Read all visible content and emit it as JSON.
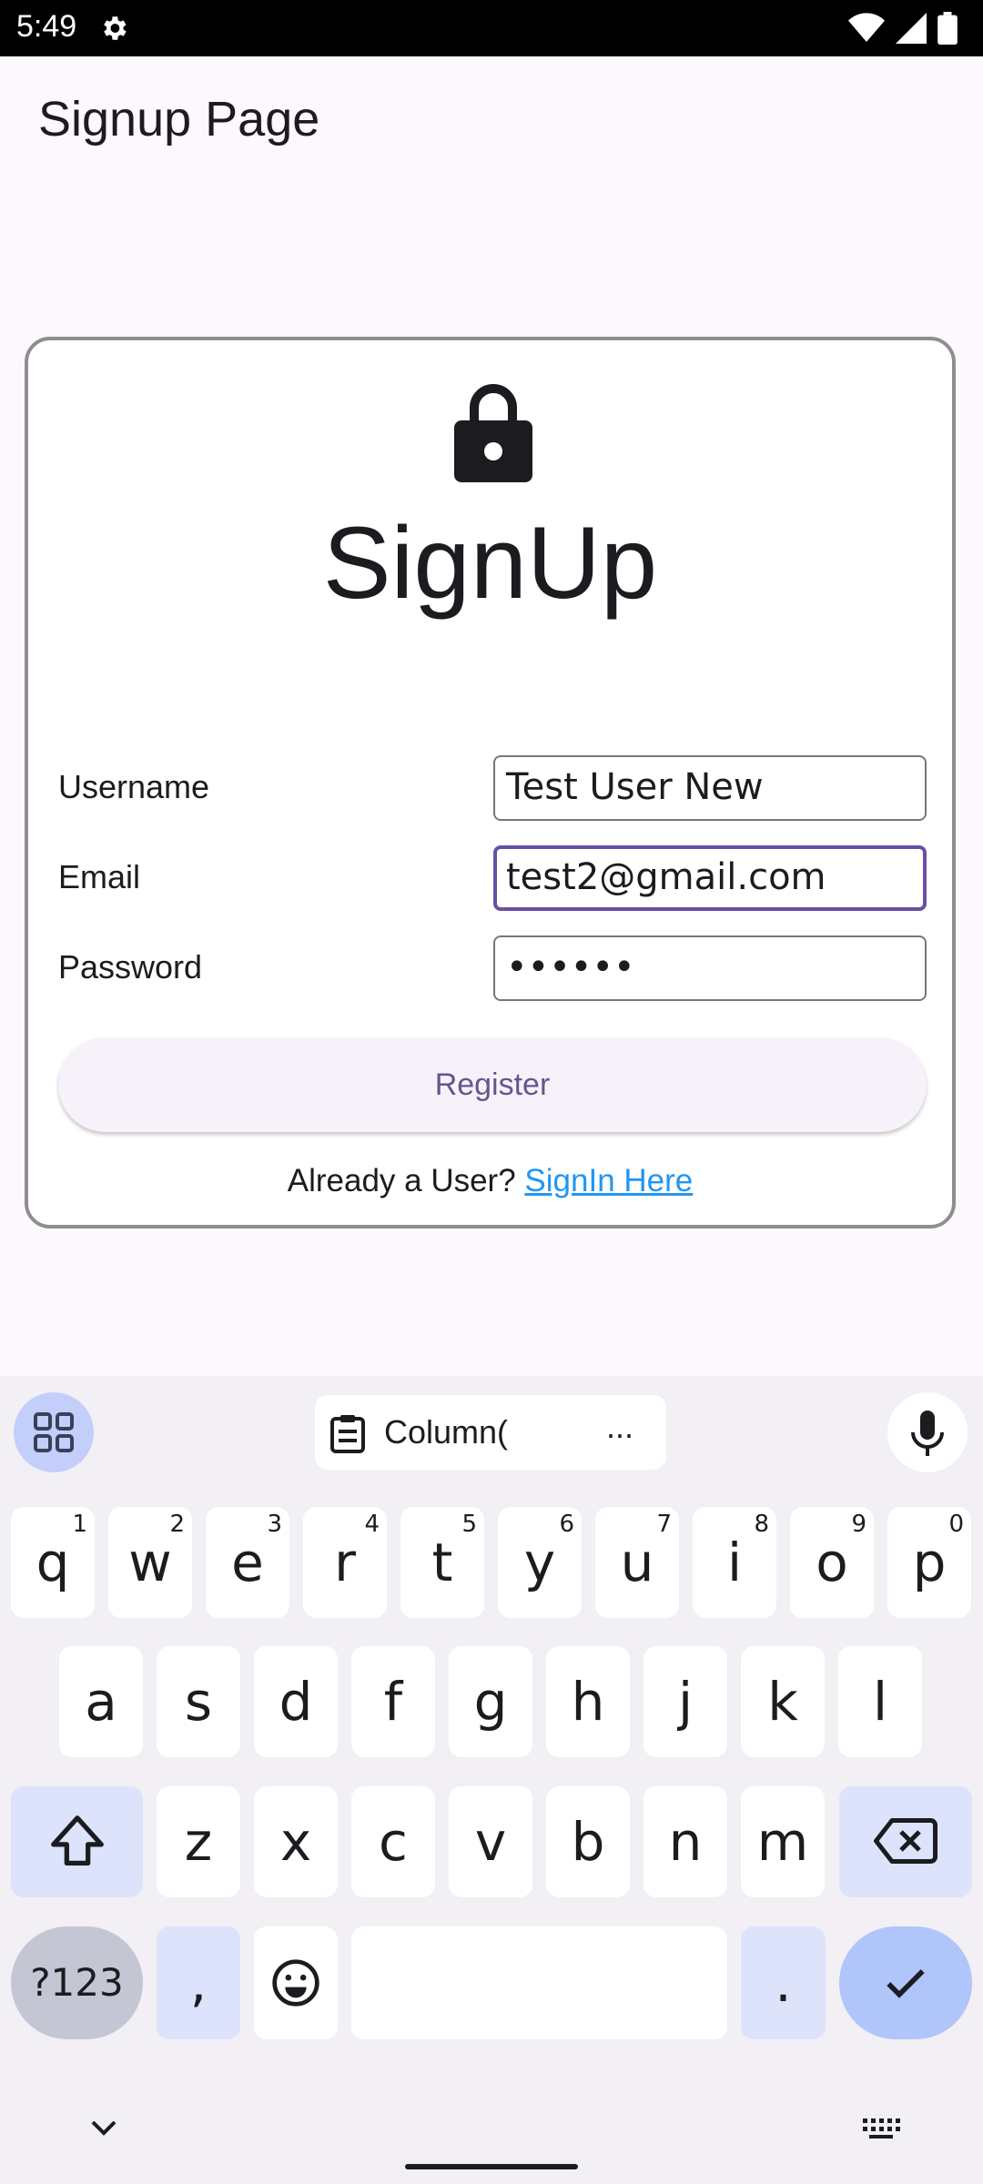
{
  "status_bar": {
    "time": "5:49"
  },
  "app_bar": {
    "title": "Signup Page"
  },
  "card": {
    "heading": "SignUp",
    "username_label": "Username",
    "username_value": "Test User New",
    "email_label": "Email",
    "email_value": "test2@gmail.com",
    "password_label": "Password",
    "password_value": "••••••",
    "register_label": "Register",
    "signin_prompt": "Already a User?",
    "signin_link": "SignIn Here"
  },
  "keyboard": {
    "suggestion": "Column(",
    "suggestion_more": "...",
    "row1": [
      "q",
      "w",
      "e",
      "r",
      "t",
      "y",
      "u",
      "i",
      "o",
      "p"
    ],
    "row1_hints": [
      "1",
      "2",
      "3",
      "4",
      "5",
      "6",
      "7",
      "8",
      "9",
      "0"
    ],
    "row2": [
      "a",
      "s",
      "d",
      "f",
      "g",
      "h",
      "j",
      "k",
      "l"
    ],
    "row3": [
      "z",
      "x",
      "c",
      "v",
      "b",
      "n",
      "m"
    ],
    "symbols_label": "?123",
    "comma": ",",
    "period": ".",
    "icons": [
      "apps-grid-icon",
      "clipboard-icon",
      "mic-icon",
      "shift-icon",
      "backspace-icon",
      "emoji-icon",
      "check-icon",
      "chevron-down-icon",
      "keyboard-icon"
    ]
  },
  "colors": {
    "accent": "#6750a4",
    "link": "#2196f3",
    "enter_key": "#b0c5f9"
  }
}
